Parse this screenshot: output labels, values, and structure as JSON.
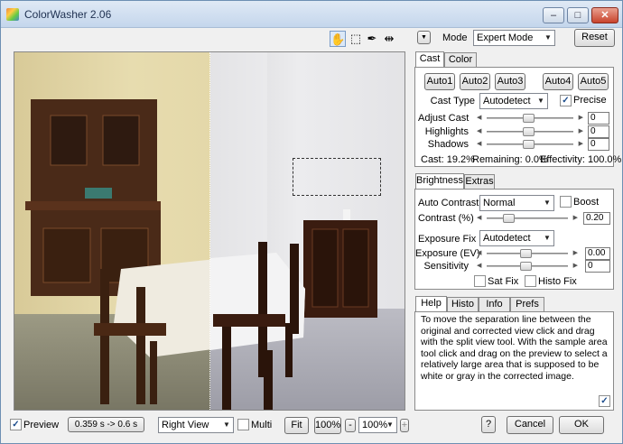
{
  "app": {
    "title": "ColorWasher 2.06",
    "win_min": "–",
    "win_max": "□",
    "win_close": "✕"
  },
  "toolbar": {
    "hand_icon": "✋",
    "select_icon": "⬚",
    "eyedrop_icon": "✒",
    "split_icon": "⇹"
  },
  "mode": {
    "arrow": "▼",
    "label": "Mode",
    "value": "Expert Mode",
    "reset": "Reset"
  },
  "cast_panel": {
    "tabs": [
      "Cast",
      "Color"
    ],
    "auto": [
      "Auto1",
      "Auto2",
      "Auto3",
      "Auto4",
      "Auto5"
    ],
    "cast_type_label": "Cast Type",
    "cast_type_value": "Autodetect",
    "precise_label": "Precise",
    "precise_checked": true,
    "adjust_cast_label": "Adjust Cast",
    "adjust_cast_value": "0",
    "highlights_label": "Highlights",
    "highlights_value": "0",
    "shadows_label": "Shadows",
    "shadows_value": "0",
    "status_cast": "Cast: 19.2%",
    "status_remaining": "Remaining: 0.0%",
    "status_effectivity": "Effectivity: 100.0%"
  },
  "brightness_panel": {
    "tabs": [
      "Brightness",
      "Extras"
    ],
    "auto_contrast_label": "Auto Contrast",
    "auto_contrast_value": "Normal",
    "boost_label": "Boost",
    "contrast_label": "Contrast (%)",
    "contrast_value": "0.20",
    "exposure_fix_label": "Exposure Fix",
    "exposure_fix_value": "Autodetect",
    "exposure_ev_label": "Exposure (EV)",
    "exposure_ev_value": "0.00",
    "sensitivity_label": "Sensitivity",
    "sensitivity_value": "0",
    "sat_fix_label": "Sat Fix",
    "histo_fix_label": "Histo Fix"
  },
  "help_panel": {
    "tabs": [
      "Help",
      "Histo",
      "Info",
      "Prefs"
    ],
    "text": "To move the separation line between the original and corrected view click and drag with the split view tool. With the sample area tool click and drag on the preview to select a relatively large area that is supposed to be white or gray in the corrected image."
  },
  "bottom": {
    "preview_label": "Preview",
    "preview_checked": true,
    "timing": "0.359 s -> 0.6 s",
    "view_value": "Right View",
    "multi_label": "Multi",
    "fit": "Fit",
    "zoom1": "100%",
    "minus": "-",
    "zoom2": "100%",
    "plus": "+",
    "help": "?",
    "cancel": "Cancel",
    "ok": "OK"
  }
}
